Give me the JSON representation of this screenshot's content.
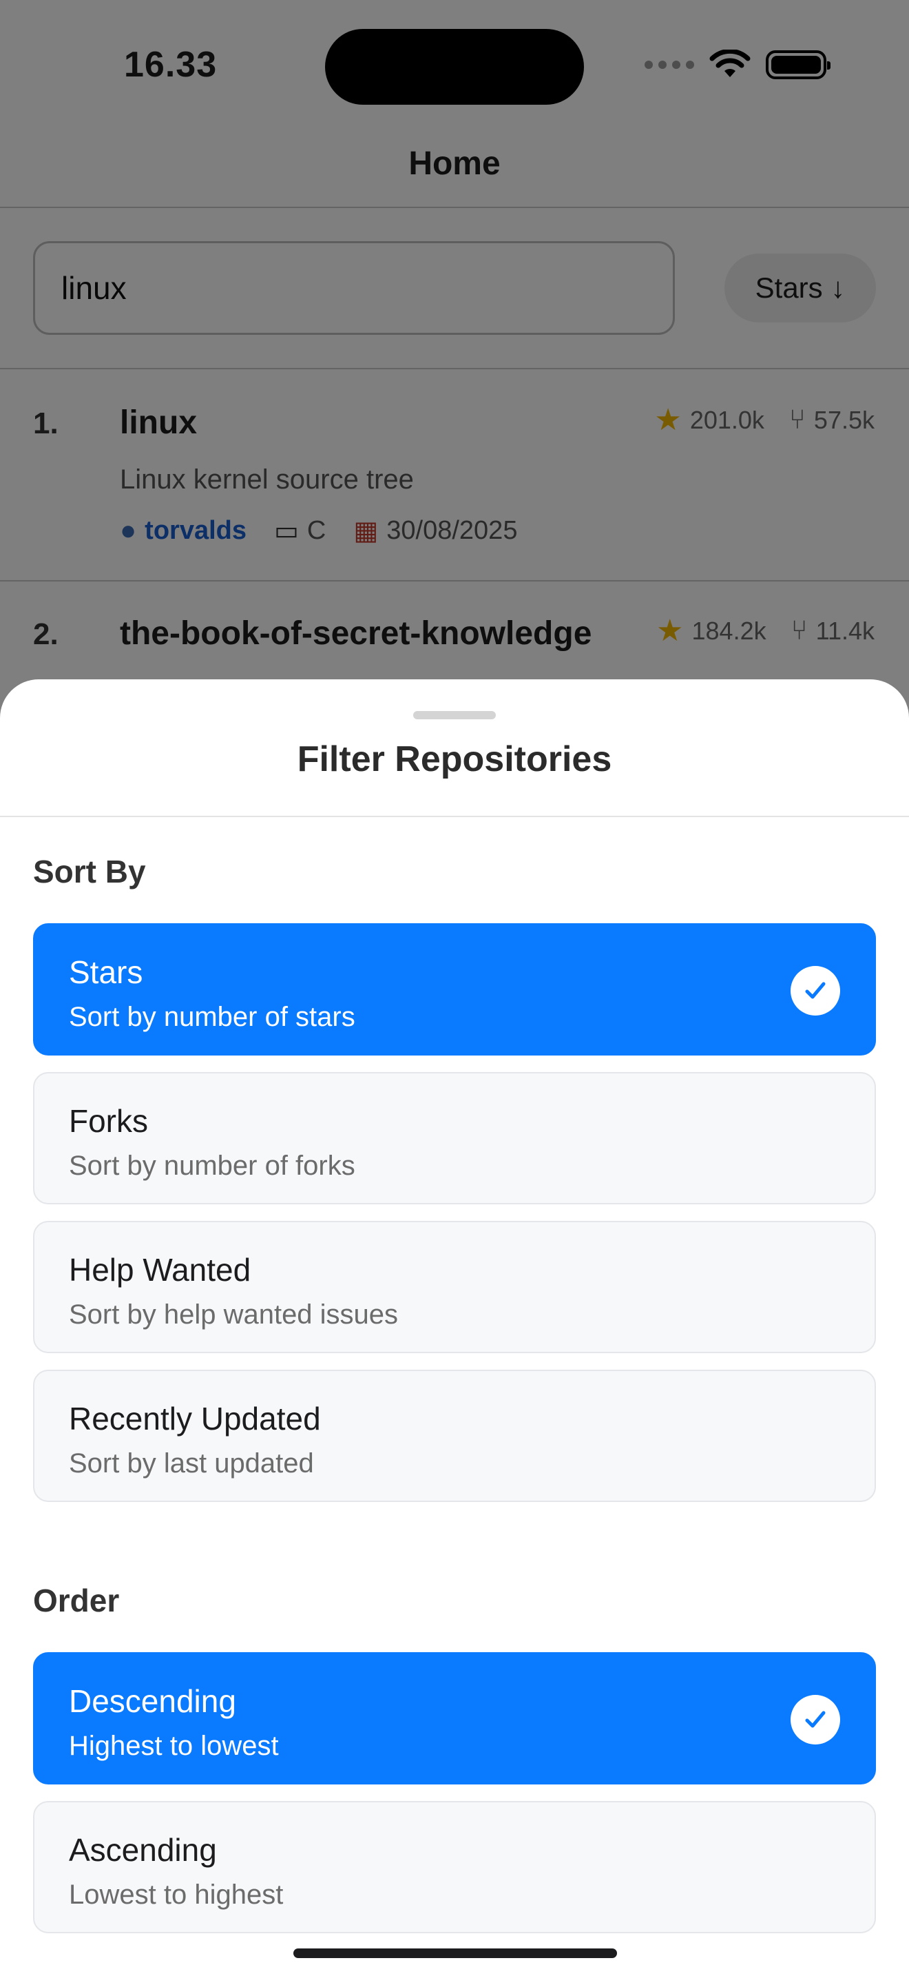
{
  "status_bar": {
    "time": "16.33"
  },
  "nav": {
    "title": "Home"
  },
  "search": {
    "value": "linux",
    "sort_chip": "Stars ↓"
  },
  "repos": [
    {
      "rank": "1.",
      "name": "linux",
      "stars": "201.0k",
      "forks": "57.5k",
      "description": "Linux kernel source tree",
      "owner": "torvalds",
      "language": "C",
      "updated": "30/08/2025"
    },
    {
      "rank": "2.",
      "name": "the-book-of-secret-knowledge",
      "stars": "184.2k",
      "forks": "11.4k"
    }
  ],
  "sheet": {
    "title": "Filter Repositories",
    "sort_section": {
      "label": "Sort By",
      "options": [
        {
          "title": "Stars",
          "subtitle": "Sort by number of stars",
          "selected": true
        },
        {
          "title": "Forks",
          "subtitle": "Sort by number of forks",
          "selected": false
        },
        {
          "title": "Help Wanted",
          "subtitle": "Sort by help wanted issues",
          "selected": false
        },
        {
          "title": "Recently Updated",
          "subtitle": "Sort by last updated",
          "selected": false
        }
      ]
    },
    "order_section": {
      "label": "Order",
      "options": [
        {
          "title": "Descending",
          "subtitle": "Highest to lowest",
          "selected": true
        },
        {
          "title": "Ascending",
          "subtitle": "Lowest to highest",
          "selected": false
        }
      ]
    }
  },
  "icons": {
    "star": "star-icon",
    "fork": "fork-icon",
    "owner": "person-icon",
    "language": "laptop-icon",
    "date": "calendar-icon",
    "check": "checkmark-icon"
  },
  "colors": {
    "accent": "#0a7aff",
    "link": "#1a5fd0",
    "overlay": "rgba(0,0,0,0.5)"
  }
}
